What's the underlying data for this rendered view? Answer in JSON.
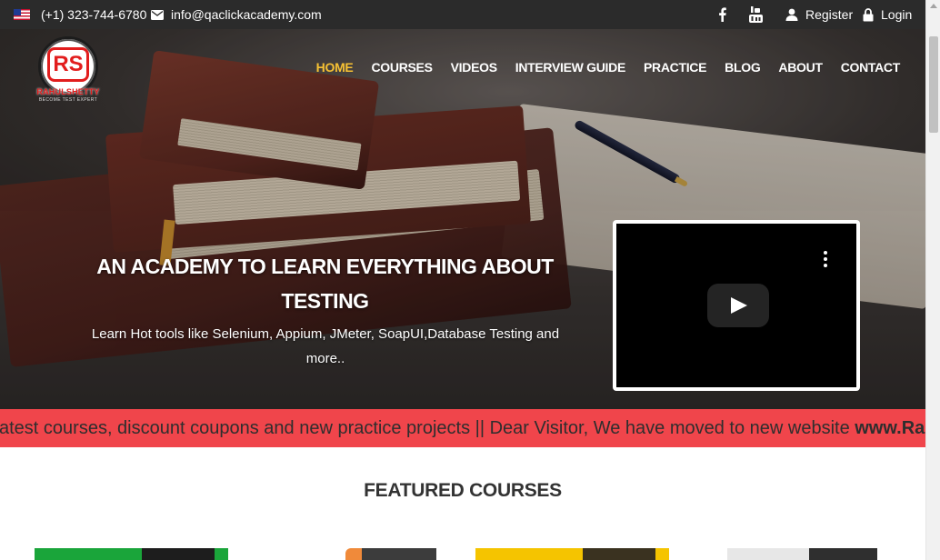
{
  "topbar": {
    "phone": "(+1) 323-744-6780",
    "email": "info@qaclickacademy.com",
    "register": "Register",
    "login": "Login"
  },
  "logo": {
    "monogram": "RS",
    "name": "RAHULSHETTY",
    "tagline": "BECOME TEST EXPERT"
  },
  "nav": {
    "items": [
      "HOME",
      "COURSES",
      "VIDEOS",
      "INTERVIEW GUIDE",
      "PRACTICE",
      "BLOG",
      "ABOUT",
      "CONTACT"
    ],
    "active": "HOME"
  },
  "hero": {
    "title": "AN ACADEMY TO LEARN EVERYTHING ABOUT TESTING",
    "subtitle": "Learn Hot tools like Selenium, Appium, JMeter, SoapUI,Database Testing and more.."
  },
  "marquee": {
    "text": "atest courses, discount coupons and new practice projects || Dear Visitor, We have moved to new website ",
    "bold": "www.Rahul"
  },
  "featured": {
    "title": "FEATURED COURSES"
  },
  "colors": {
    "accent": "#f7c133",
    "marquee": "#f0454b",
    "topbar": "#2b2b2b",
    "brand_red": "#e21d1d"
  }
}
